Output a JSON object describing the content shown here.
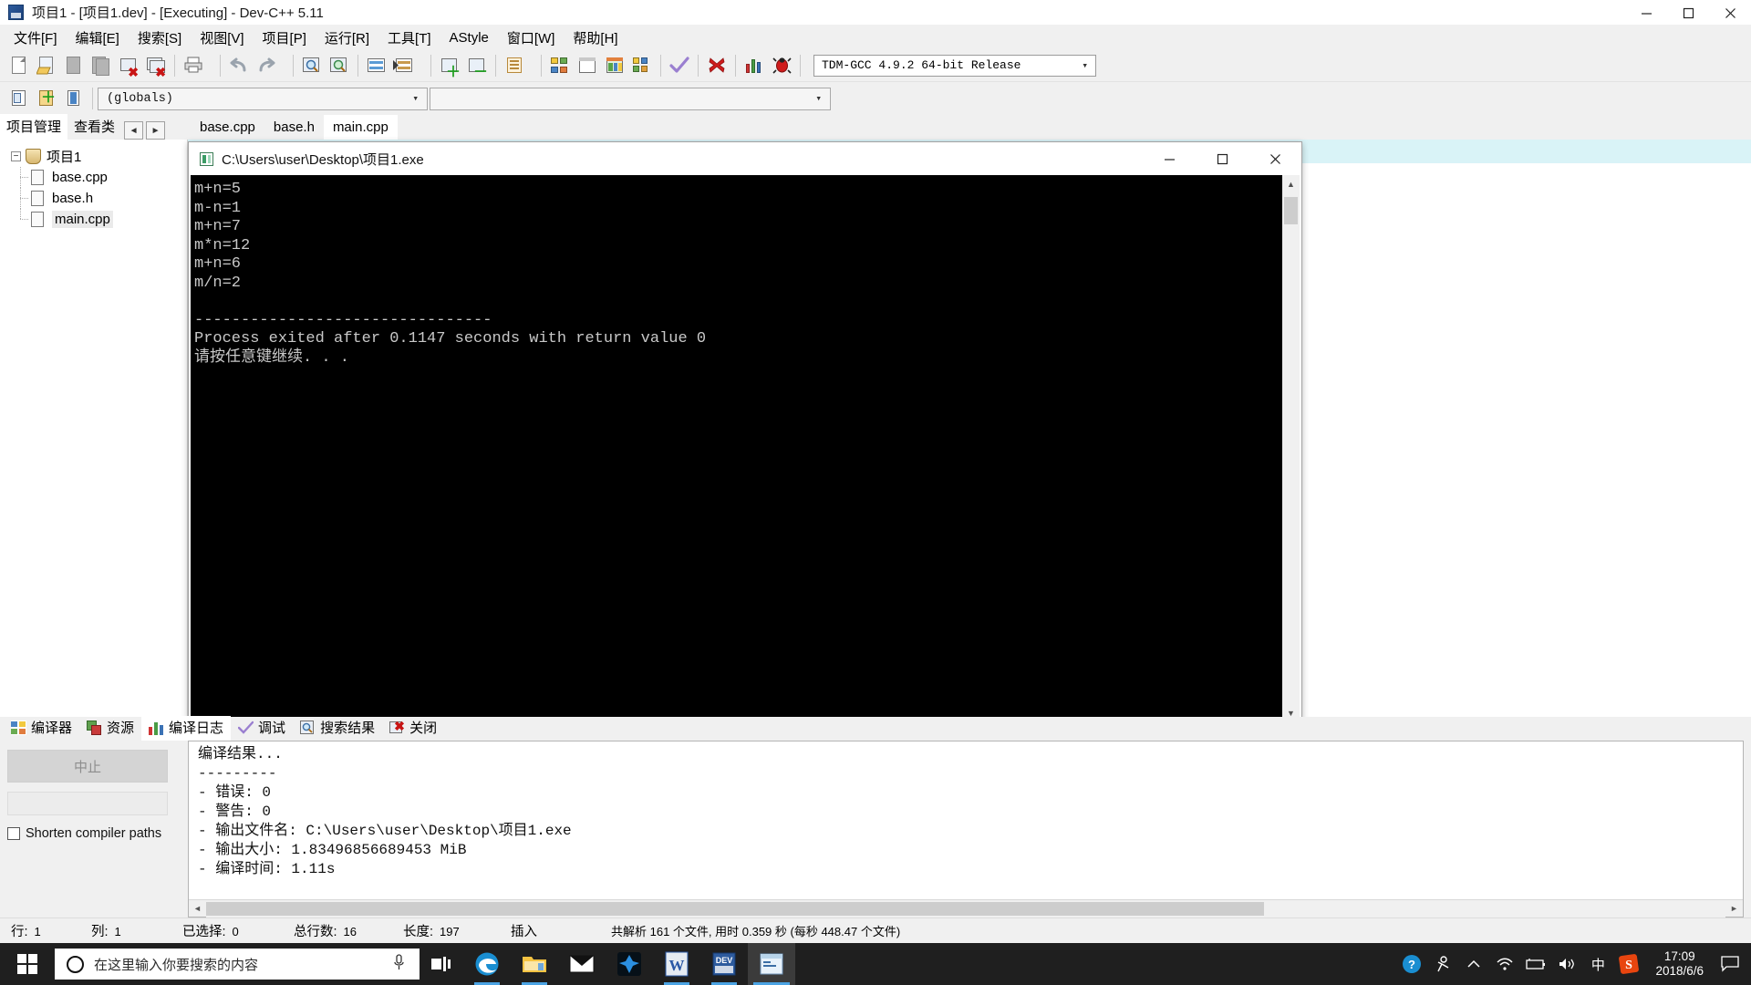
{
  "window": {
    "title": "项目1 - [项目1.dev] - [Executing] - Dev-C++ 5.11",
    "icon": "devcpp-icon",
    "minimize": "minimize-icon",
    "maximize": "maximize-icon",
    "close": "close-icon"
  },
  "menubar": {
    "items": [
      {
        "label": "文件[F]"
      },
      {
        "label": "编辑[E]"
      },
      {
        "label": "搜索[S]"
      },
      {
        "label": "视图[V]"
      },
      {
        "label": "项目[P]"
      },
      {
        "label": "运行[R]"
      },
      {
        "label": "工具[T]"
      },
      {
        "label": "AStyle"
      },
      {
        "label": "窗口[W]"
      },
      {
        "label": "帮助[H]"
      }
    ]
  },
  "toolbar": {
    "compiler_select_value": "TDM-GCC 4.9.2 64-bit Release",
    "caret": "▾",
    "icons": [
      "new-file-icon",
      "open-file-icon",
      "save-icon",
      "save-all-icon",
      "close-file-icon",
      "close-all-icon",
      "print-icon",
      "undo-icon",
      "redo-icon",
      "find-icon",
      "replace-icon",
      "goto-line-icon",
      "goto-function-icon",
      "add-to-project-icon",
      "remove-from-project-icon",
      "project-options-icon",
      "compile-icon",
      "run-icon",
      "compile-and-run-icon",
      "rebuild-all-icon",
      "syntax-check-icon",
      "stop-execution-icon",
      "profile-icon",
      "debug-icon"
    ]
  },
  "toolbar2": {
    "scope_value": "(globals)",
    "member_value": "",
    "caret": "▾",
    "icons": [
      "insert-icon",
      "toggle-breakpoint-icon",
      "goto-declaration-icon"
    ]
  },
  "left_panel": {
    "tabs": [
      {
        "label": "项目管理",
        "active": true
      },
      {
        "label": "查看类",
        "active": false
      }
    ],
    "nav_prev": "◄",
    "nav_next": "►",
    "tree": {
      "root": {
        "label": "项目1",
        "expander": "−",
        "icon": "project-icon"
      },
      "children": [
        {
          "label": "base.cpp",
          "icon": "file-icon",
          "selected": false
        },
        {
          "label": "base.h",
          "icon": "file-icon",
          "selected": false
        },
        {
          "label": "main.cpp",
          "icon": "file-icon",
          "selected": true
        }
      ]
    }
  },
  "editor": {
    "tabs": [
      {
        "label": "base.cpp",
        "active": false
      },
      {
        "label": "base.h",
        "active": false
      },
      {
        "label": "main.cpp",
        "active": true
      }
    ]
  },
  "console": {
    "title": "C:\\Users\\user\\Desktop\\项目1.exe",
    "icon": "console-icon",
    "minimize": "minimize-icon",
    "maximize": "maximize-icon",
    "close": "close-icon",
    "output": "m+n=5\nm-n=1\nm+n=7\nm*n=12\nm+n=6\nm/n=2\n\n--------------------------------\nProcess exited after 0.1147 seconds with return value 0\n请按任意键继续. . .",
    "scroll_up": "▲",
    "scroll_down": "▼"
  },
  "bottom_panel": {
    "tabs": [
      {
        "label": "编译器",
        "icon": "compiler-icon",
        "active": false
      },
      {
        "label": "资源",
        "icon": "resource-icon",
        "active": false
      },
      {
        "label": "编译日志",
        "icon": "log-icon",
        "active": true
      },
      {
        "label": "调试",
        "icon": "debug-icon",
        "active": false
      },
      {
        "label": "搜索结果",
        "icon": "search-results-icon",
        "active": false
      },
      {
        "label": "关闭",
        "icon": "close-panel-icon",
        "active": false
      }
    ],
    "abort_button": "中止",
    "shorten_paths_label": "Shorten compiler paths",
    "shorten_paths_checked": false,
    "log": "编译结果...\n---------\n- 错误: 0\n- 警告: 0\n- 输出文件名: C:\\Users\\user\\Desktop\\项目1.exe\n- 输出大小: 1.83496856689453 MiB\n- 编译时间: 1.11s",
    "hscroll_left": "◄",
    "hscroll_right": "►"
  },
  "statusbar": {
    "cells": [
      {
        "label": "行:",
        "value": "1"
      },
      {
        "label": "列:",
        "value": "1"
      },
      {
        "label": "已选择:",
        "value": "0"
      },
      {
        "label": "总行数:",
        "value": "16"
      },
      {
        "label": "长度:",
        "value": "197"
      },
      {
        "label": "插入",
        "value": ""
      }
    ],
    "parse_info": "共解析 161 个文件, 用时 0.359 秒 (每秒 448.47 个文件)"
  },
  "taskbar": {
    "start": "windows-start-icon",
    "search_placeholder": "在这里输入你要搜索的内容",
    "search_circle": "cortana-icon",
    "mic": "microphone-icon",
    "task_view": "task-view-icon",
    "apps": [
      {
        "name": "edge-icon",
        "state": "open"
      },
      {
        "name": "file-explorer-icon",
        "state": "open"
      },
      {
        "name": "mail-icon",
        "state": "idle"
      },
      {
        "name": "photoshop-icon",
        "state": "idle"
      },
      {
        "name": "word-icon",
        "state": "open"
      },
      {
        "name": "devcpp-icon",
        "state": "open"
      },
      {
        "name": "console-app-icon",
        "state": "active"
      }
    ],
    "tray": [
      "help-icon",
      "people-icon",
      "show-hidden-icon",
      "wifi-icon",
      "battery-icon",
      "volume-icon"
    ],
    "ime": "中",
    "sogou": "S",
    "time": "17:09",
    "date": "2018/6/6",
    "action_center": "action-center-icon"
  },
  "colors": {
    "titlebar_bg": "#ffffff",
    "chrome_bg": "#f0f0f0",
    "console_bg": "#000000",
    "console_fg": "#c8c8c8",
    "taskbar_bg": "#1f1f1f",
    "accent": "#4ba3e3",
    "editor_strip": "#d9f3f7"
  }
}
